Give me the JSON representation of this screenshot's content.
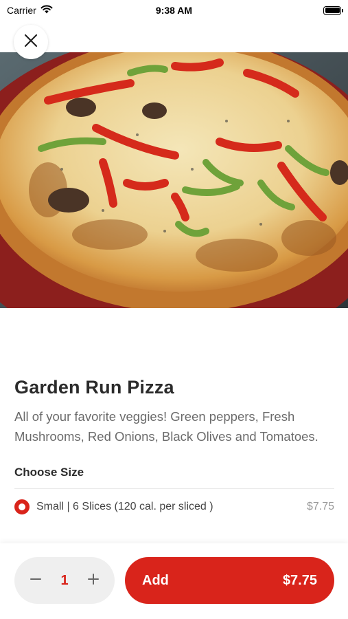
{
  "status_bar": {
    "carrier": "Carrier",
    "time": "9:38 AM",
    "battery_level": 1.0
  },
  "close_button": {
    "icon": "close-icon"
  },
  "item": {
    "image": "pizza-photo",
    "title": "Garden Run Pizza",
    "description": "All of your favorite veggies! Green peppers, Fresh Mushrooms, Red Onions, Black Olives and Tomatoes."
  },
  "size_section": {
    "title": "Choose Size",
    "options": [
      {
        "label": "Small | 6 Slices (120 cal. per sliced )",
        "price": "$7.75",
        "selected": true
      }
    ]
  },
  "bottom_bar": {
    "quantity": "1",
    "decrement_icon": "minus-icon",
    "increment_icon": "plus-icon",
    "add_label": "Add",
    "add_price": "$7.75"
  },
  "colors": {
    "accent": "#d9241b",
    "stepper_bg": "#efefef",
    "text_dark": "#2b2b2b",
    "text_muted": "#6b6b6b"
  }
}
